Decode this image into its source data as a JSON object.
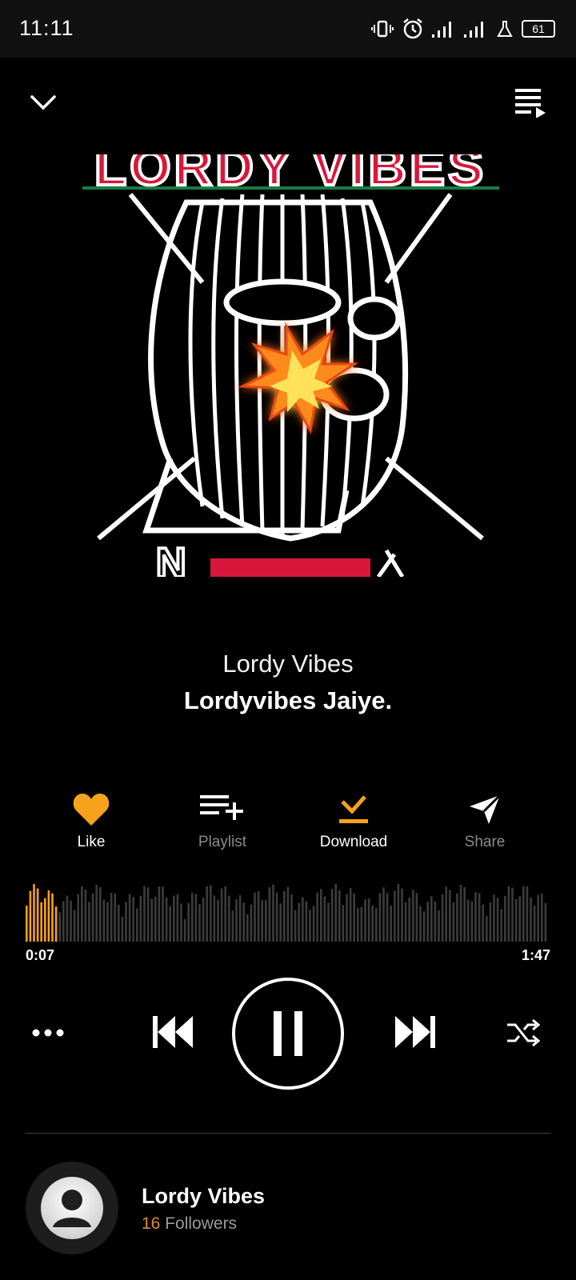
{
  "status_bar": {
    "time": "11:11",
    "battery": "61",
    "icons": [
      "vibrate-icon",
      "alarm-icon",
      "signal-icon",
      "signal-icon",
      "lab-icon",
      "battery-icon"
    ]
  },
  "top_bar": {
    "collapse_icon": "chevron-down-icon",
    "queue_icon": "queue-playlist-icon"
  },
  "album_art": {
    "text_top": "LORDY VIBES"
  },
  "track": {
    "artist": "Lordy Vibes",
    "title": "Lordyvibes  Jaiye."
  },
  "actions": {
    "like": "Like",
    "playlist": "Playlist",
    "download": "Download",
    "share": "Share"
  },
  "progress": {
    "elapsed": "0:07",
    "duration": "1:47",
    "fraction": 0.065
  },
  "controls": {
    "more_icon": "more-dots-icon",
    "prev_icon": "skip-previous-icon",
    "pause_icon": "pause-icon",
    "next_icon": "skip-next-icon",
    "shuffle_icon": "shuffle-icon"
  },
  "artist_card": {
    "name": "Lordy Vibes",
    "followers_count": "16",
    "followers_label": "Followers"
  },
  "colors": {
    "accent": "#f7a21b",
    "background": "#000000",
    "muted": "#8a8a8a",
    "wave_inactive": "#3c3c3c"
  }
}
